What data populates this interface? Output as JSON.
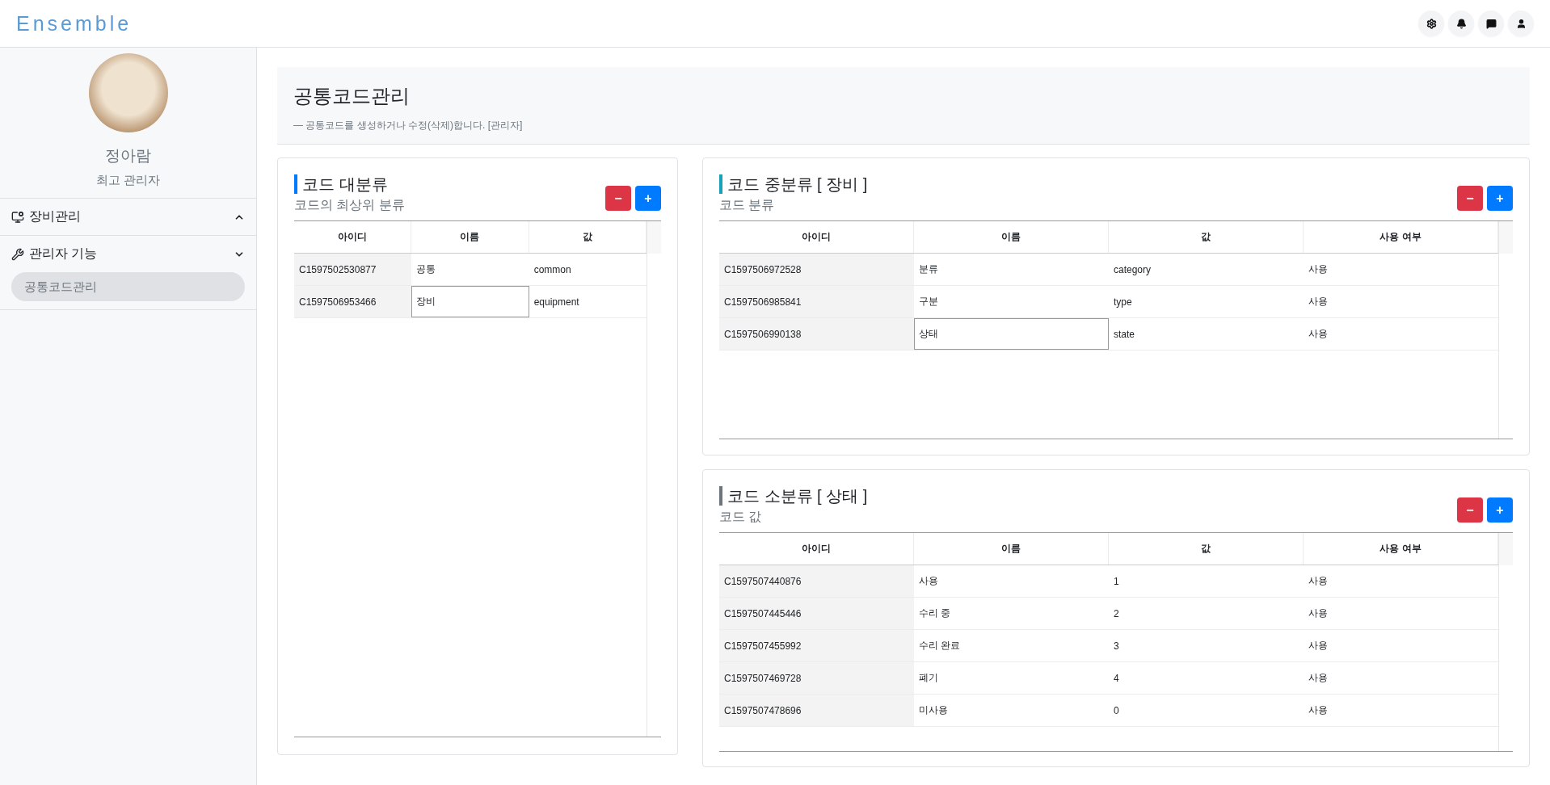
{
  "header": {
    "logo": "Ensemble"
  },
  "sidebar": {
    "user": {
      "name": "정아람",
      "role": "최고 관리자"
    },
    "menus": [
      {
        "label": "장비관리",
        "kind": "equipment",
        "expanded": false
      },
      {
        "label": "관리자 기능",
        "kind": "admin",
        "expanded": true,
        "children": [
          {
            "label": "공통코드관리",
            "selected": true
          }
        ]
      }
    ]
  },
  "page": {
    "title": "공통코드관리",
    "subtitle": "— 공통코드를 생성하거나 수정(삭제)합니다. [관리자]"
  },
  "panels": [
    {
      "title": "코드 대분류",
      "subtitle": "코드의 최상위 분류",
      "color": "#007bff",
      "buttons": [
        "−",
        "+"
      ],
      "columns": [
        "아이디",
        "이름",
        "값"
      ],
      "rows": [
        {
          "cells": [
            "C1597502530877",
            "공통",
            "common"
          ],
          "selected": false
        },
        {
          "cells": [
            "C1597506953466",
            "장비",
            "equipment"
          ],
          "selected": true
        }
      ]
    },
    {
      "title": "코드 중분류 [ 장비 ]",
      "subtitle": "코드 분류",
      "color": "#17a2b8",
      "buttons": [
        "−",
        "+"
      ],
      "columns": [
        "아이디",
        "이름",
        "값",
        "사용 여부"
      ],
      "rows": [
        {
          "cells": [
            "C1597506972528",
            "분류",
            "category",
            "사용"
          ],
          "selected": false
        },
        {
          "cells": [
            "C1597506985841",
            "구분",
            "type",
            "사용"
          ],
          "selected": false
        },
        {
          "cells": [
            "C1597506990138",
            "상태",
            "state",
            "사용"
          ],
          "selected": true
        }
      ]
    },
    {
      "title": "코드 소분류 [ 상태 ]",
      "subtitle": "코드 값",
      "color": "#6c757d",
      "buttons": [
        "−",
        "+"
      ],
      "columns": [
        "아이디",
        "이름",
        "값",
        "사용 여부"
      ],
      "rows": [
        {
          "cells": [
            "C1597507440876",
            "사용",
            "1",
            "사용"
          ],
          "selected": false
        },
        {
          "cells": [
            "C1597507445446",
            "수리 중",
            "2",
            "사용"
          ],
          "selected": false
        },
        {
          "cells": [
            "C1597507455992",
            "수리 완료",
            "3",
            "사용"
          ],
          "selected": false
        },
        {
          "cells": [
            "C1597507469728",
            "폐기",
            "4",
            "사용"
          ],
          "selected": false
        },
        {
          "cells": [
            "C1597507478696",
            "미사용",
            "0",
            "사용"
          ],
          "selected": false
        }
      ]
    }
  ]
}
